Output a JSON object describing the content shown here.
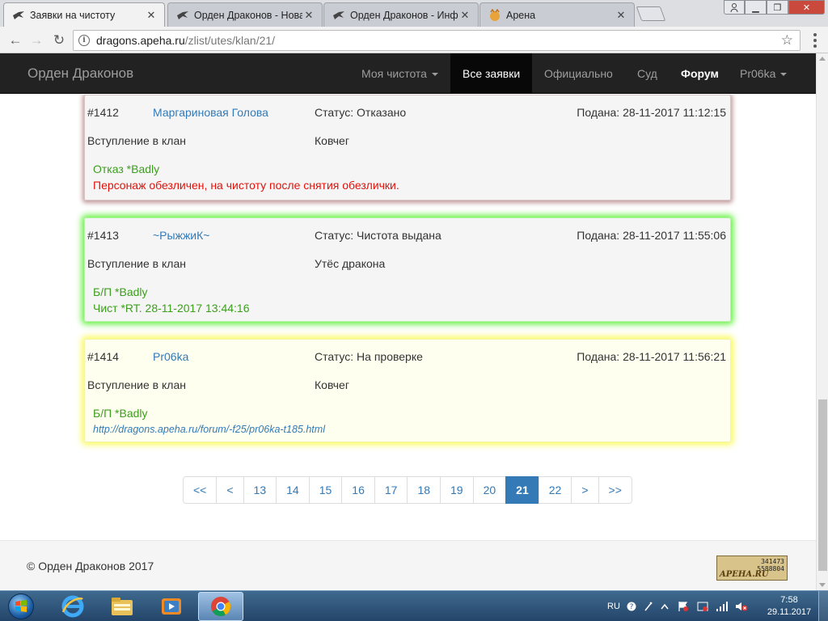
{
  "browser": {
    "tabs": [
      {
        "title": "Заявки на чистоту",
        "active": true
      },
      {
        "title": "Орден Драконов - Нова",
        "active": false
      },
      {
        "title": "Орден Драконов - Инф",
        "active": false
      },
      {
        "title": "Арена",
        "active": false
      }
    ],
    "url_host": "dragons.apeha.ru",
    "url_path": "/zlist/utes/klan/21/"
  },
  "navbar": {
    "brand": "Орден Драконов",
    "items": [
      {
        "label": "Моя чистота",
        "dropdown": true
      },
      {
        "label": "Все заявки",
        "active": true
      },
      {
        "label": "Официально"
      },
      {
        "label": "Суд"
      },
      {
        "label": "Форум",
        "bold": true
      },
      {
        "label": "Pr06ka",
        "dropdown": true
      }
    ]
  },
  "requests": [
    {
      "id": "#1412",
      "name": "Маргариновая Голова",
      "status": "Статус: Отказано",
      "submitted": "Подана: 28-11-2017 11:12:15",
      "type": "Вступление в клан",
      "clan": "Ковчег",
      "note1": "Отказ *Badly",
      "note2": "Персонаж обезличен, на чистоту после снятия обезлички."
    },
    {
      "id": "#1413",
      "name": "~РыжжиК~",
      "status": "Статус: Чистота выдана",
      "submitted": "Подана: 28-11-2017 11:55:06",
      "type": "Вступление в клан",
      "clan": "Утёс дракона",
      "note1": "Б/П *Badly",
      "note2": "Чист *RT. 28-11-2017 13:44:16"
    },
    {
      "id": "#1414",
      "name": "Pr06ka",
      "status": "Статус: На проверке",
      "submitted": "Подана: 28-11-2017 11:56:21",
      "type": "Вступление в клан",
      "clan": "Ковчег",
      "note1": "Б/П *Badly",
      "note2": "http://dragons.apeha.ru/forum/-f25/pr06ka-t185.html"
    }
  ],
  "pagination": {
    "first": "<<",
    "prev": "<",
    "pages": [
      "13",
      "14",
      "15",
      "16",
      "17",
      "18",
      "19",
      "20",
      "21",
      "22"
    ],
    "current": "21",
    "next": ">",
    "last": ">>"
  },
  "footer": {
    "copyright": "© Орден Драконов 2017",
    "counter_logo": "APEHA.RU",
    "counter_line1": "341473",
    "counter_line2": "5588804"
  },
  "taskbar": {
    "language": "RU",
    "time": "7:58",
    "date": "29.11.2017"
  },
  "colors": {
    "navbar_bg": "#222222",
    "link": "#337ab7",
    "status_green": "#3c9e1c",
    "status_red": "#e3120b"
  }
}
